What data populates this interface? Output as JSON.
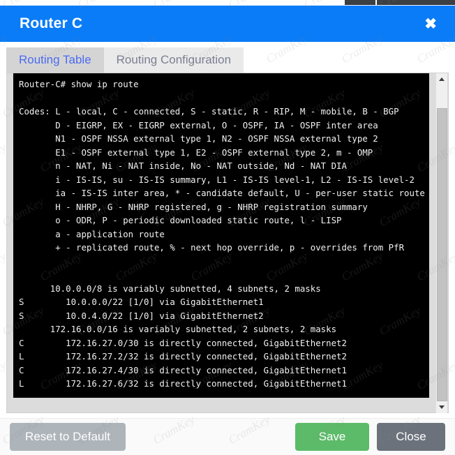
{
  "dialog": {
    "title": "Router C",
    "close_icon": "close-icon",
    "close_glyph": "✖"
  },
  "tabs": [
    {
      "label": "Routing Table",
      "active": true
    },
    {
      "label": "Routing Configuration",
      "active": false
    }
  ],
  "terminal": {
    "prompt_line": "Router-C# show ip route",
    "lines": [
      "Router-C# show ip route",
      "",
      "Codes: L - local, C - connected, S - static, R - RIP, M - mobile, B - BGP",
      "       D - EIGRP, EX - EIGRP external, O - OSPF, IA - OSPF inter area",
      "       N1 - OSPF NSSA external type 1, N2 - OSPF NSSA external type 2",
      "       E1 - OSPF external type 1, E2 - OSPF external type 2, m - OMP",
      "       n - NAT, Ni - NAT inside, No - NAT outside, Nd - NAT DIA",
      "       i - IS-IS, su - IS-IS summary, L1 - IS-IS level-1, L2 - IS-IS level-2",
      "       ia - IS-IS inter area, * - candidate default, U - per-user static route",
      "       H - NHRP, G - NHRP registered, g - NHRP registration summary",
      "       o - ODR, P - periodic downloaded static route, l - LISP",
      "       a - application route",
      "       + - replicated route, % - next hop override, p - overrides from PfR",
      "",
      "",
      "      10.0.0.0/8 is variably subnetted, 4 subnets, 2 masks",
      "S        10.0.0.0/22 [1/0] via GigabitEthernet1",
      "S        10.0.4.0/22 [1/0] via GigabitEthernet2",
      "      172.16.0.0/16 is variably subnetted, 2 subnets, 2 masks",
      "C        172.16.27.0/30 is directly connected, GigabitEthernet2",
      "L        172.16.27.2/32 is directly connected, GigabitEthernet2",
      "C        172.16.27.4/30 is directly connected, GigabitEthernet1",
      "L        172.16.27.6/32 is directly connected, GigabitEthernet1"
    ]
  },
  "scrollbar": {
    "up_arrow": "scroll-up-arrow-icon",
    "down_arrow": "scroll-down-arrow-icon"
  },
  "footer": {
    "reset_label": "Reset to Default",
    "save_label": "Save",
    "close_label": "Close"
  },
  "colors": {
    "header_blue": "#0a7cf7",
    "save_green": "#5cbb68",
    "close_gray": "#6b727b",
    "reset_gray": "#adb4ba",
    "tab_active_text": "#4a6bf0",
    "terminal_bg": "#000000",
    "terminal_text": "#f2f2f2"
  },
  "watermark": {
    "text": "CramKey"
  }
}
